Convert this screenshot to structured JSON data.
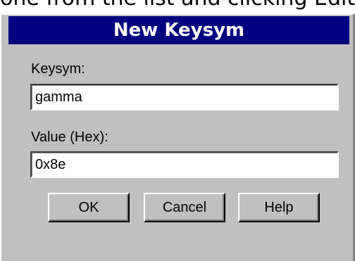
{
  "background_text": "one from the list and clicking Edit or",
  "dialog": {
    "title": "New Keysym",
    "keysym": {
      "label": "Keysym:",
      "value": "gamma"
    },
    "value_hex": {
      "label": "Value (Hex):",
      "value": "0x8e"
    },
    "buttons": {
      "ok": "OK",
      "cancel": "Cancel",
      "help": "Help"
    }
  },
  "colors": {
    "title_bar": "#000080",
    "dialog_face": "#c0c0c0",
    "field_bg": "#ffffff"
  }
}
